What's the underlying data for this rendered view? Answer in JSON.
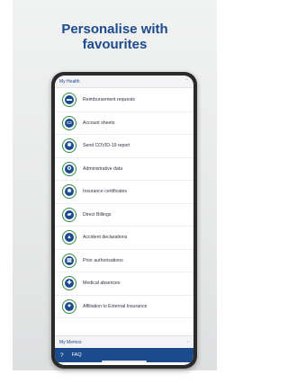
{
  "headline": {
    "line1": "Personalise with",
    "line2": "favourites"
  },
  "accordion": {
    "title": "My Health",
    "chevron_icon": "chevron-up-icon"
  },
  "menu_items": [
    {
      "label": "Reimbursement requests",
      "icon": "wallet-icon",
      "glyph": "▬"
    },
    {
      "label": "Account sheets",
      "icon": "card-icon",
      "glyph": "▭"
    },
    {
      "label": "Send COVID-19 report",
      "icon": "virus-icon",
      "glyph": "✱"
    },
    {
      "label": "Administrative data",
      "icon": "gear-icon",
      "glyph": "⚙"
    },
    {
      "label": "Insurance certificates",
      "icon": "certificate-icon",
      "glyph": "❀"
    },
    {
      "label": "Direct Billings",
      "icon": "truck-icon",
      "glyph": "▰"
    },
    {
      "label": "Accident declarations",
      "icon": "warning-icon",
      "glyph": "▲"
    },
    {
      "label": "Prior authorisations",
      "icon": "document-icon",
      "glyph": "▤"
    },
    {
      "label": "Medical absences",
      "icon": "medical-bag-icon",
      "glyph": "✚"
    },
    {
      "label": "Affiliation to External Insurance",
      "icon": "puzzle-icon",
      "glyph": "✦"
    }
  ],
  "memos": {
    "title": "My Memos",
    "chevron": "›"
  },
  "faq": {
    "label": "FAQ",
    "icon_glyph": "?"
  },
  "colors": {
    "brand_blue": "#1b4a8d",
    "icon_ring_green": "#2e8a3e"
  }
}
